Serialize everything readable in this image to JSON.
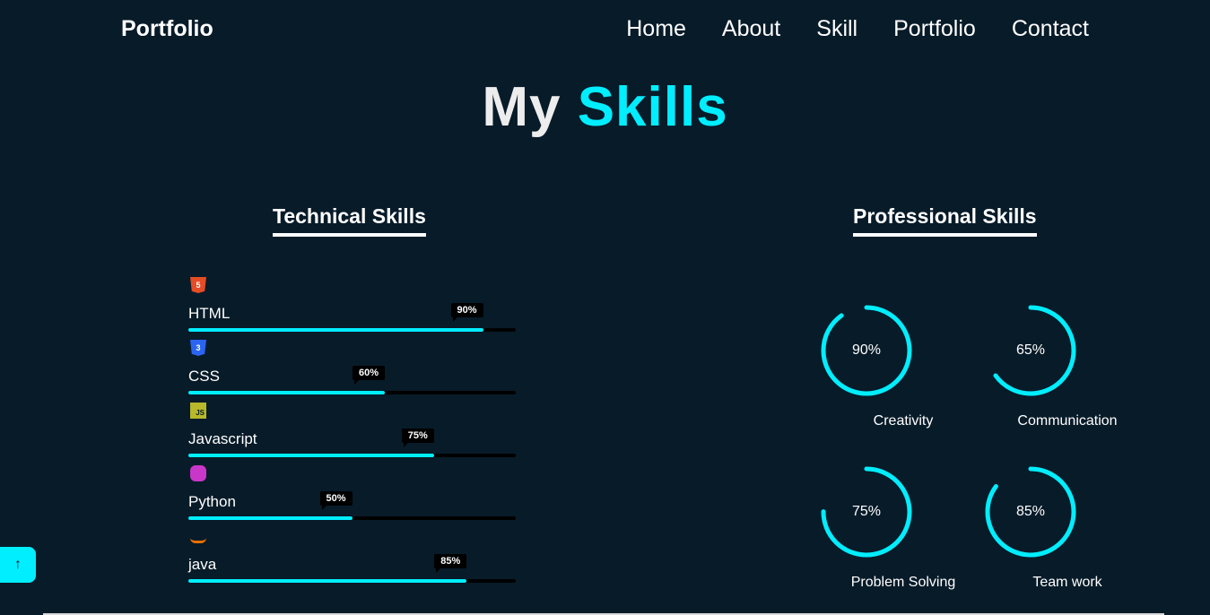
{
  "header": {
    "logo": "Portfolio",
    "nav": [
      "Home",
      "About",
      "Skill",
      "Portfolio",
      "Contact"
    ]
  },
  "title": {
    "word1": "My",
    "word2": "Skills"
  },
  "technical": {
    "heading": "Technical Skills",
    "skills": [
      {
        "name": "HTML",
        "percent_label": "90%",
        "level": 90,
        "icon": "html5-icon",
        "icon_text": "5",
        "color": "#e44d26"
      },
      {
        "name": "CSS",
        "percent_label": "60%",
        "level": 60,
        "icon": "css3-icon",
        "icon_text": "3",
        "color": "#2965f1"
      },
      {
        "name": "Javascript",
        "percent_label": "75%",
        "level": 75,
        "icon": "javascript-icon",
        "icon_text": "JS",
        "color": "#b8b82a"
      },
      {
        "name": "Python",
        "percent_label": "50%",
        "level": 50,
        "icon": "python-icon",
        "icon_text": "",
        "color": "#c837c8"
      },
      {
        "name": "java",
        "percent_label": "85%",
        "level": 85,
        "icon": "java-icon",
        "icon_text": "",
        "color": "#e76f00"
      }
    ]
  },
  "professional": {
    "heading": "Professional Skills",
    "skills": [
      {
        "name": "Creativity",
        "percent_label": "90%",
        "level": 90
      },
      {
        "name": "Communication",
        "percent_label": "65%",
        "level": 65
      },
      {
        "name": "Problem Solving",
        "percent_label": "75%",
        "level": 75
      },
      {
        "name": "Team work",
        "percent_label": "85%",
        "level": 85
      }
    ]
  },
  "scroll_top": {
    "icon": "arrow-up-icon",
    "glyph": "↑"
  },
  "colors": {
    "accent": "#00eeff",
    "background": "#081b29",
    "track": "#000000"
  }
}
